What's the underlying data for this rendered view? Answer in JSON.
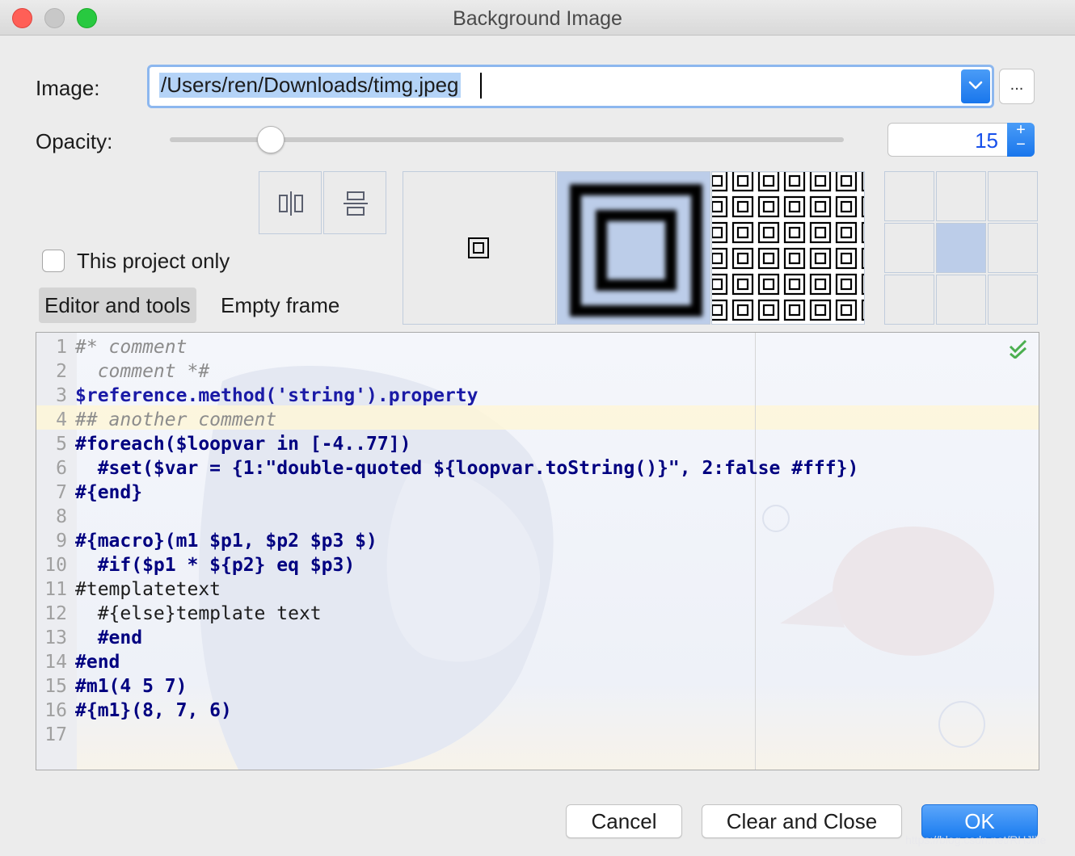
{
  "window": {
    "title": "Background Image"
  },
  "image": {
    "label": "Image:",
    "path": "/Users/ren/Downloads/timg.jpeg",
    "browse_label": "..."
  },
  "opacity": {
    "label": "Opacity:",
    "value": "15",
    "slider_fraction": 0.15
  },
  "checkbox": {
    "label": "This project only",
    "checked": false
  },
  "tabs": [
    {
      "label": "Editor and tools",
      "active": true
    },
    {
      "label": "Empty frame",
      "active": false
    }
  ],
  "fill_modes": [
    "center",
    "scale",
    "tile"
  ],
  "selected_fill_mode": "scale",
  "anchor": {
    "selected_cell": 4
  },
  "editor": {
    "lines": [
      "#* comment",
      "  comment *#",
      "$reference.method('string').property",
      "## another comment",
      "#foreach($loopvar in [-4..77])",
      "  #set($var = {1:\"double-quoted ${loopvar.toString()}\", 2:false #fff})",
      "#{end}",
      "",
      "#{macro}(m1 $p1, $p2 $p3 $)",
      "  #if($p1 * ${p2} eq $p3)",
      "#templatetext",
      "  #{else}template text",
      "  #end",
      "#end",
      "#m1(4 5 7)",
      "#{m1}(8, 7, 6)",
      ""
    ],
    "caret_line": 4
  },
  "buttons": {
    "cancel": "Cancel",
    "clear_close": "Clear and Close",
    "ok": "OK"
  },
  "watermark": "https://blog.csdn.net/RHJlife",
  "colors": {
    "accent": "#1a7cf0",
    "selection": "#bccde9",
    "caret_row": "#fef6d8"
  }
}
